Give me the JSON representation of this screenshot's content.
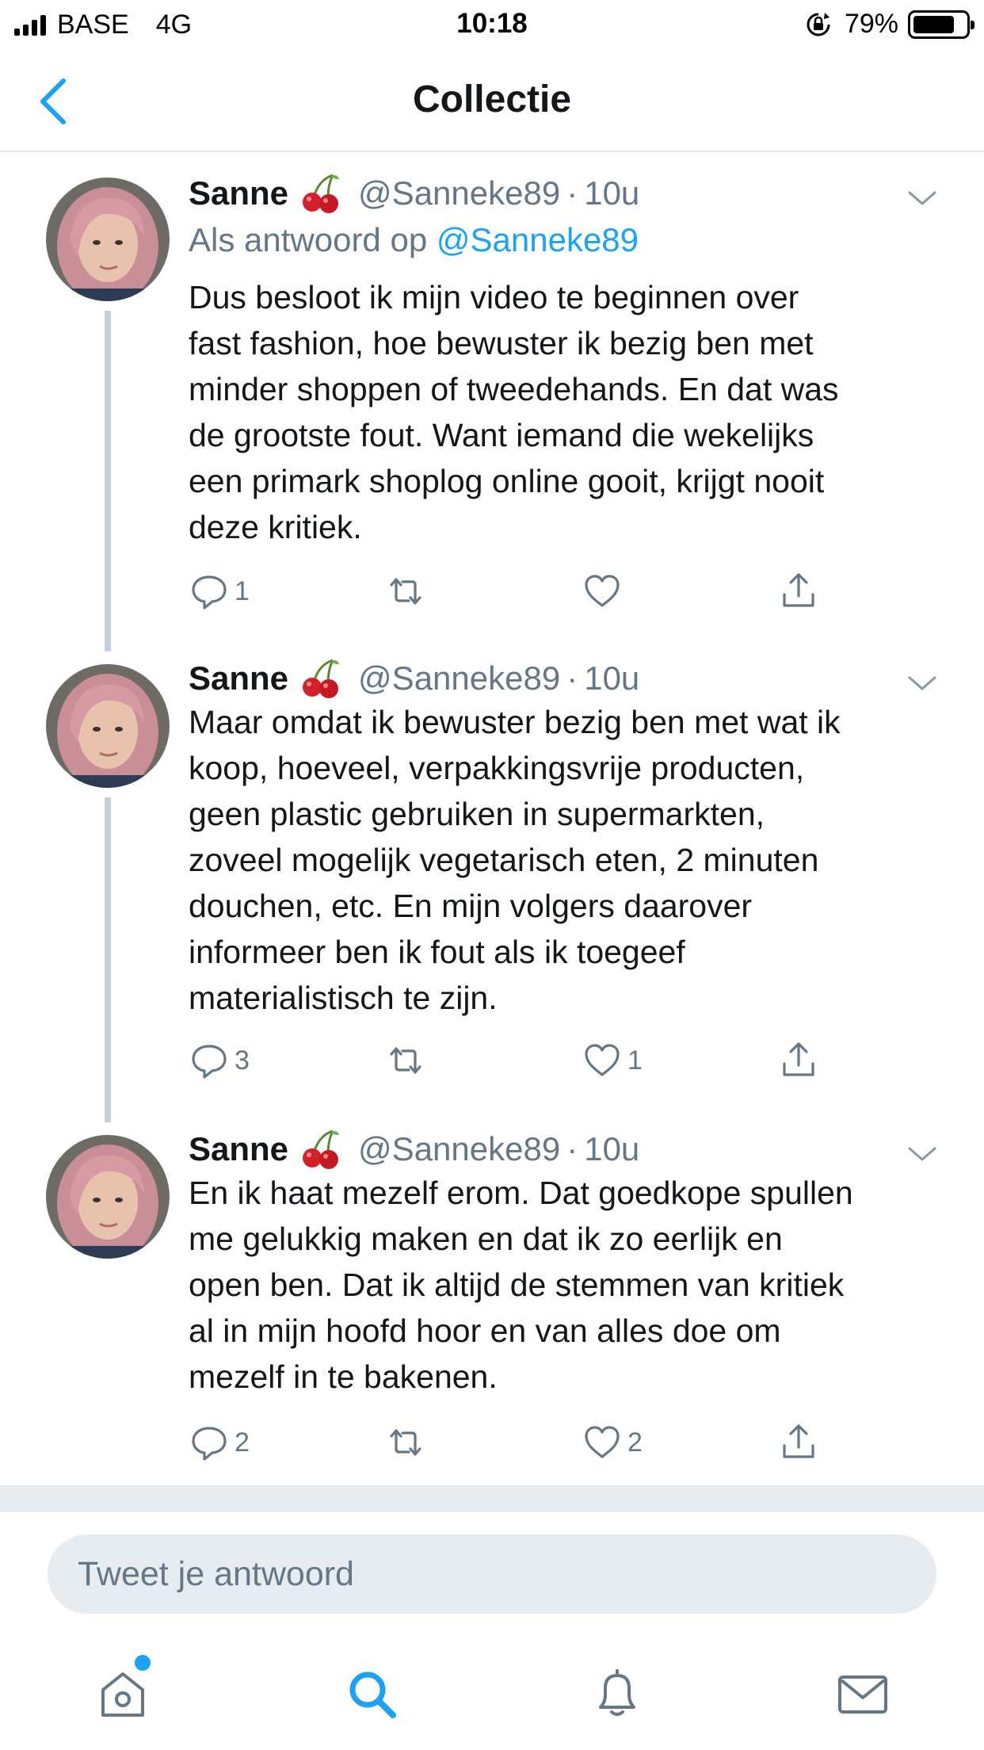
{
  "status_bar": {
    "carrier": "BASE",
    "network": "4G",
    "time": "10:18",
    "battery": "79%",
    "battery_level": 0.79
  },
  "nav": {
    "title": "Collectie"
  },
  "tweets": [
    {
      "name": "Sanne",
      "handle": "@Sanneke89",
      "separator": "·",
      "time": "10u",
      "reply_prefix": "Als antwoord op",
      "reply_handle": "@Sanneke89",
      "text": "Dus besloot ik mijn video te beginnen over\nfast fashion, hoe bewuster ik bezig ben met\nminder shoppen of tweedehands. En dat was\nde grootste fout. Want iemand die wekelijks\neen primark shoplog online gooit, krijgt nooit\ndeze kritiek.",
      "replies": "1",
      "retweets": "",
      "likes": ""
    },
    {
      "name": "Sanne",
      "handle": "@Sanneke89",
      "separator": "·",
      "time": "10u",
      "text": "Maar omdat ik bewuster bezig ben met wat ik\nkoop, hoeveel, verpakkingsvrije producten,\ngeen plastic gebruiken in supermarkten,\nzoveel mogelijk vegetarisch eten, 2 minuten\ndouchen, etc. En mijn volgers daarover\ninformeer ben ik fout als ik toegeef\nmaterialistisch te zijn.",
      "replies": "3",
      "retweets": "",
      "likes": "1"
    },
    {
      "name": "Sanne",
      "handle": "@Sanneke89",
      "separator": "·",
      "time": "10u",
      "text": "En ik haat mezelf erom. Dat goedkope spullen\nme gelukkig maken en dat ik zo eerlijk en\nopen ben. Dat ik altijd de stemmen van kritiek\nal in mijn hoofd hoor en van alles doe om\nmezelf in te bakenen.",
      "replies": "2",
      "retweets": "",
      "likes": "2"
    }
  ],
  "reply_bar": {
    "placeholder": "Tweet je antwoord"
  },
  "tabs": [
    "home-icon",
    "search-icon",
    "notifications-icon",
    "messages-icon"
  ],
  "colors": {
    "accent": "#1da1f2",
    "secondary_text": "#657786",
    "thread_line": "#c4d1dc",
    "separator": "#e6ecf0"
  }
}
